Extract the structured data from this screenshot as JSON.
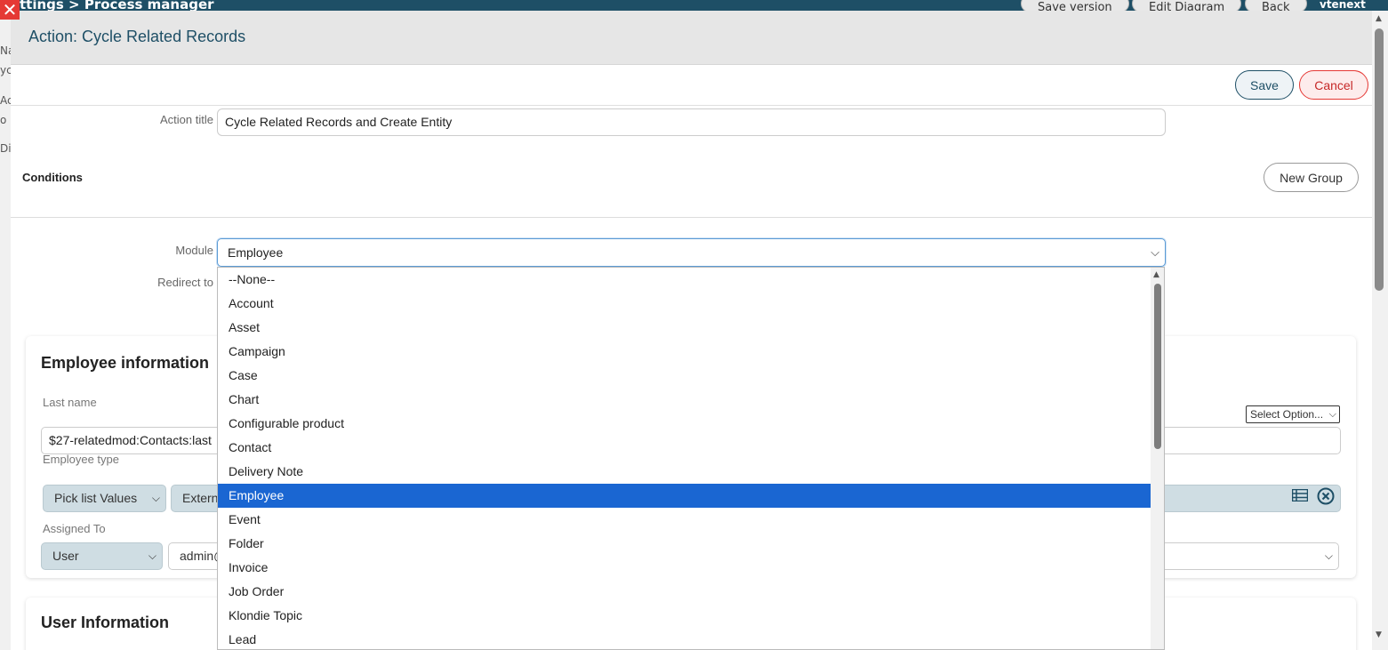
{
  "background": {
    "breadcrumb": "ttings > Process manager",
    "buttons": [
      "Save version",
      "Edit Diagram",
      "Back"
    ],
    "brand": "vtenext",
    "left_fragments": [
      "Na",
      "yc",
      "Act",
      "o",
      "Dia"
    ]
  },
  "modal": {
    "title": "Action: Cycle Related Records",
    "save_label": "Save",
    "cancel_label": "Cancel",
    "action_title_label": "Action title",
    "action_title_value": "Cycle Related Records and Create Entity",
    "conditions_label": "Conditions",
    "new_group_label": "New Group",
    "module_label": "Module",
    "module_value": "Employee",
    "redirect_label": "Redirect to"
  },
  "employee_card": {
    "title": "Employee information",
    "last_name_label": "Last name",
    "last_name_value": "$27-relatedmod:Contacts:last",
    "select_option": "Select Option...",
    "employee_type_label": "Employee type",
    "employee_type_source": "Pick list Values",
    "employee_type_value": "Extern",
    "assigned_to_label": "Assigned To",
    "assigned_to_type": "User",
    "assigned_to_value": "admin@"
  },
  "user_card": {
    "title": "User Information"
  },
  "dropdown": {
    "options": [
      "--None--",
      "Account",
      "Asset",
      "Campaign",
      "Case",
      "Chart",
      "Configurable product",
      "Contact",
      "Delivery Note",
      "Employee",
      "Event",
      "Folder",
      "Invoice",
      "Job Order",
      "Klondie Topic",
      "Lead"
    ],
    "selected": "Employee"
  },
  "colors": {
    "accent": "#1e4f66",
    "selected_bg": "#1a66d2",
    "cancel": "#e53935"
  }
}
